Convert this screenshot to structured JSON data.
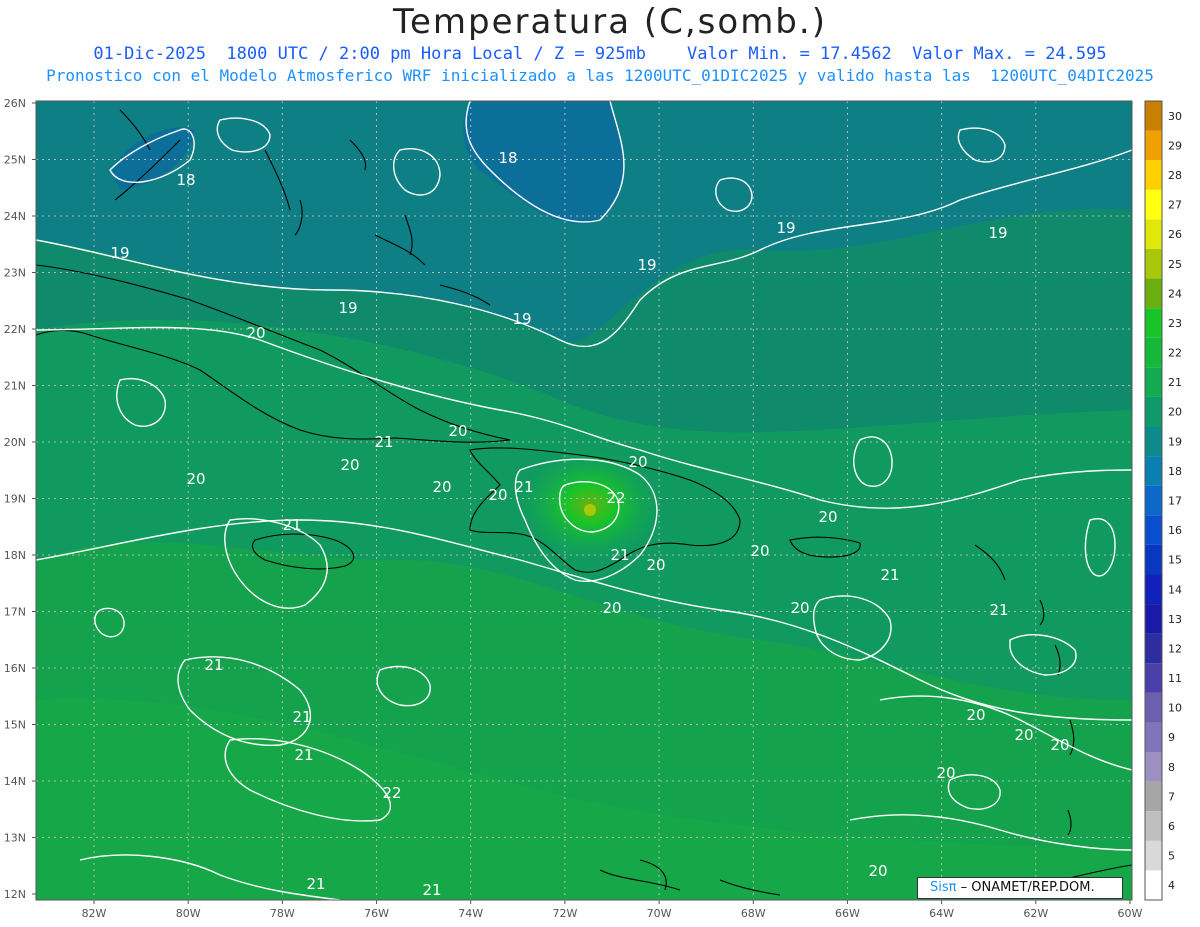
{
  "title": "Temperatura (C,somb.)",
  "subtitle_line1": "01-Dic-2025  1800 UTC / 2:00 pm Hora Local / Z = 925mb    Valor Min. = 17.4562  Valor Max. = 24.595",
  "subtitle_line2": "Pronostico con el Modelo Atmosferico WRF inicializado a las 1200UTC_01DIC2025 y valido hasta las  1200UTC_04DIC2025",
  "latitude_labels": [
    "26N",
    "25N",
    "24N",
    "23N",
    "22N",
    "21N",
    "20N",
    "19N",
    "18N",
    "17N",
    "16N",
    "15N",
    "14N",
    "13N",
    "12N"
  ],
  "longitude_labels": [
    "82W",
    "80W",
    "78W",
    "76W",
    "74W",
    "72W",
    "70W",
    "68W",
    "66W",
    "64W",
    "62W",
    "60W"
  ],
  "colorbar": {
    "levels": [
      "4",
      "5",
      "6",
      "7",
      "8",
      "9",
      "10",
      "11",
      "12",
      "13",
      "14",
      "15",
      "16",
      "17",
      "18",
      "19",
      "20",
      "21",
      "22",
      "23",
      "24",
      "25",
      "26",
      "27",
      "28",
      "29",
      "30"
    ],
    "colors": [
      "#ffffff",
      "#d9d9d9",
      "#bfbfbf",
      "#a6a6a6",
      "#9c8fc2",
      "#8274b8",
      "#6b5fb0",
      "#4a3fa8",
      "#2d2da0",
      "#1a1aa8",
      "#1020b8",
      "#0a36c4",
      "#0a4ed0",
      "#0a68c8",
      "#0a80b0",
      "#0e8a8a",
      "#109a6a",
      "#14aa50",
      "#16b83c",
      "#18c428",
      "#6cb010",
      "#a8c80a",
      "#e0e80a",
      "#ffff10",
      "#ffd000",
      "#f0a000",
      "#c88000"
    ]
  },
  "contour_labels": [
    "18",
    "18",
    "19",
    "19",
    "19",
    "19",
    "19",
    "19",
    "20",
    "20",
    "20",
    "20",
    "20",
    "20",
    "20",
    "20",
    "20",
    "20",
    "20",
    "20",
    "21",
    "21",
    "21",
    "21",
    "21",
    "21",
    "21",
    "21",
    "22"
  ],
  "credit": {
    "sis": "Sisπ",
    "sep": " – ",
    "org": "ONAMET/REP.DOM."
  },
  "colors": {
    "land_outline": "#000000",
    "contour": "#ffffff",
    "grid": "#b8b8b8",
    "sea_base": "#0f8a6a"
  }
}
